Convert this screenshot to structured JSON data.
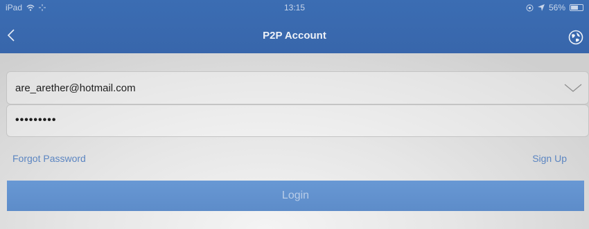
{
  "status_bar": {
    "device": "iPad",
    "time": "13:15",
    "battery": "56%"
  },
  "nav": {
    "title": "P2P Account",
    "back_icon": "chevron-left-icon",
    "right_icon": "globe-icon"
  },
  "form": {
    "email_value": "are_arether@hotmail.com",
    "password_value": "•••••••••"
  },
  "links": {
    "forgot": "Forgot Password",
    "signup": "Sign Up"
  },
  "login": {
    "label": "Login"
  },
  "colors": {
    "nav_bg": "#3866ab",
    "link": "#5b85c1",
    "button_bg": "#5d8cc9"
  }
}
